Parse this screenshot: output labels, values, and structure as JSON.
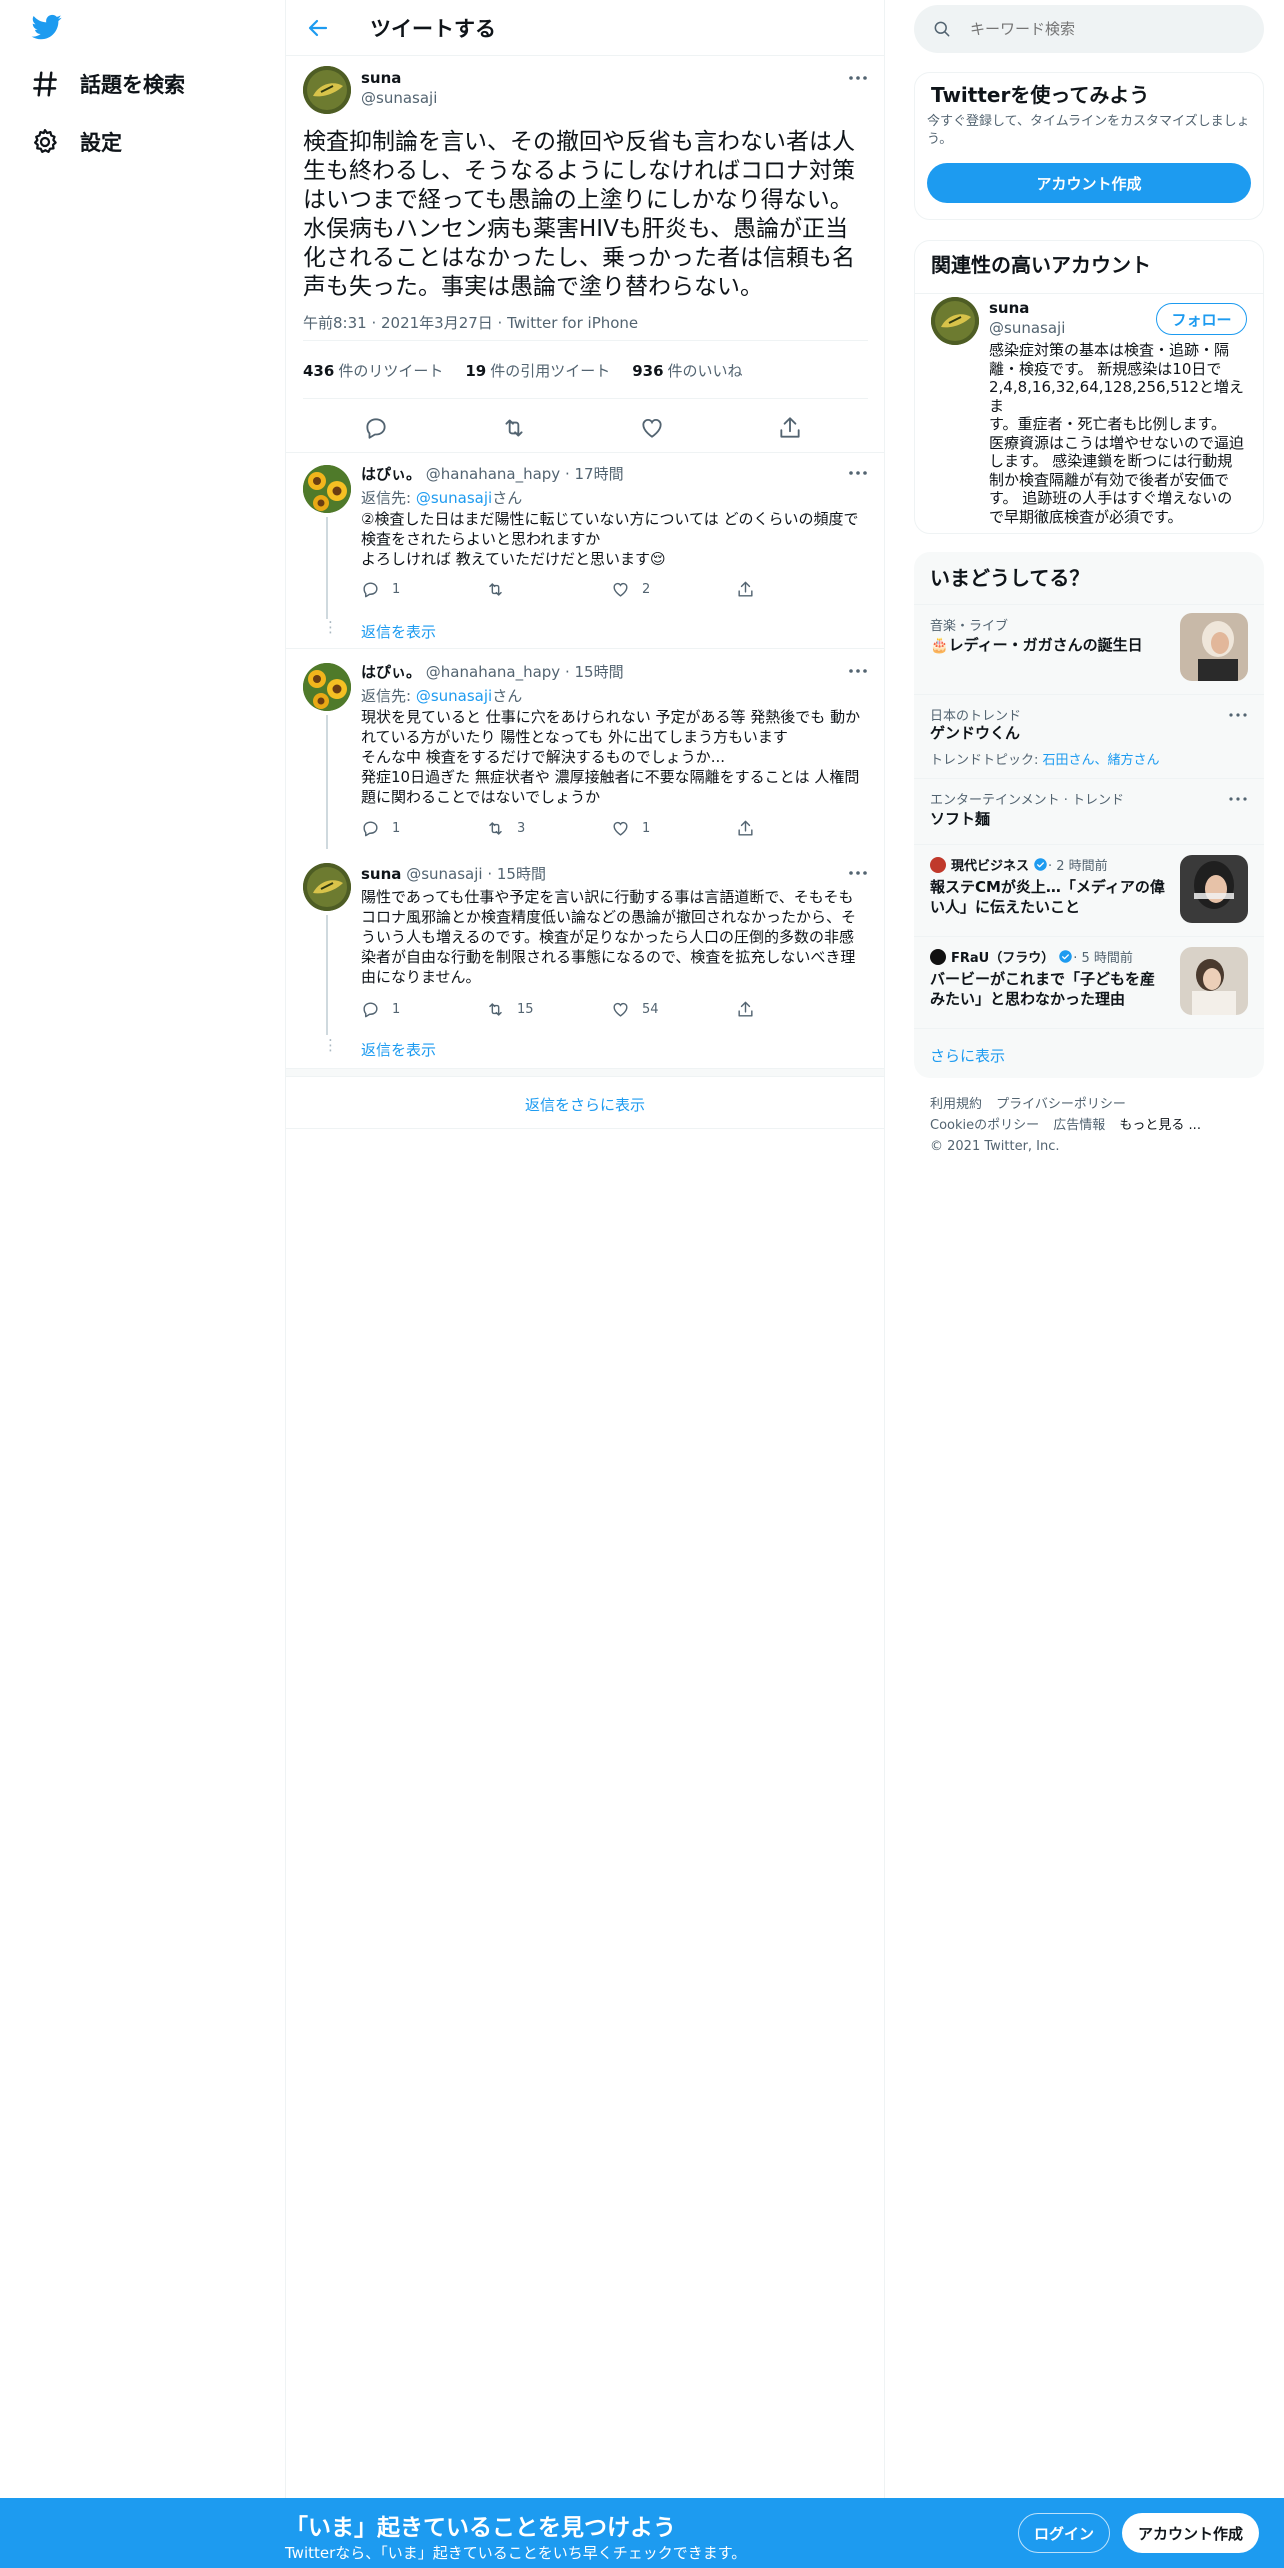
{
  "nav": {
    "explore_label": "話題を検索",
    "settings_label": "設定"
  },
  "header": {
    "title": "ツイートする"
  },
  "tweet": {
    "name": "suna",
    "handle": "@sunasaji",
    "text": "検査抑制論を言い、その撤回や反省も言わない者は人生も終わるし、そうなるようにしなければコロナ対策はいつまで経っても愚論の上塗りにしかなり得ない。水俣病もハンセン病も薬害HIVも肝炎も、愚論が正当化されることはなかったし、乗っかった者は信頼も名声も失った。事実は愚論で塗り替わらない。",
    "meta": "午前8:31 · 2021年3月27日 · Twitter for iPhone",
    "retweets_count": "436",
    "retweets_label": "件のリツイート",
    "quotes_count": "19",
    "quotes_label": "件の引用ツイート",
    "likes_count": "936",
    "likes_label": "件のいいね"
  },
  "replies": [
    {
      "name": "はぴぃ。",
      "handle_time": "@hanahana_hapy · 17時間",
      "reply_prefix": "返信先: ",
      "reply_to": "@sunasaji",
      "reply_suffix": "さん",
      "lines": [
        "②検査した日はまだ陽性に転じていない方については どのくらいの頻度で",
        "検査をされたらよいと思われますか",
        "よろしければ 教えていただけだと思います😌"
      ],
      "reply_count": "1",
      "retweet_count": "",
      "like_count": "2"
    },
    {
      "name": "はぴぃ。",
      "handle_time": "@hanahana_hapy · 15時間",
      "reply_prefix": "返信先: ",
      "reply_to": "@sunasaji",
      "reply_suffix": "さん",
      "lines": [
        "現状を見ていると 仕事に穴をあけられない 予定がある等 発熱後でも 動か",
        "れている方がいたり 陽性となっても 外に出てしまう方もいます",
        "そんな中 検査をするだけで解決するものでしょうか...",
        "発症10日過ぎた 無症状者や 濃厚接触者に不要な隔離をすることは 人権問",
        "題に関わることではないでしょうか"
      ],
      "reply_count": "1",
      "retweet_count": "3",
      "like_count": "1"
    },
    {
      "name": "suna",
      "handle_time": "@sunasaji · 15時間",
      "lines": [
        "陽性であっても仕事や予定を言い訳に行動する事は言語道断で、そもそも",
        "コロナ風邪論とか検査精度低い論などの愚論が撤回されなかったから、そ",
        "ういう人も増えるのです。検査が足りなかったら人口の圧倒的多数の非感",
        "染者が自由な行動を制限される事態になるので、検査を拡充しないべき理",
        "由になりません。"
      ],
      "reply_count": "1",
      "retweet_count": "15",
      "like_count": "54"
    }
  ],
  "show_replies_label": "返信を表示",
  "more_replies_label": "返信をさらに表示",
  "search": {
    "placeholder": "キーワード検索"
  },
  "signup_card": {
    "title": "Twitterを使ってみよう",
    "desc": "今すぐ登録して、タイムラインをカスタマイズしましょう。",
    "button": "アカウント作成"
  },
  "related": {
    "title": "関連性の高いアカウント",
    "name": "suna",
    "handle": "@sunasaji",
    "follow": "フォロー",
    "bio": [
      "感染症対策の基本は検査・追跡・隔",
      "離・検疫です。 新規感染は10日で",
      "2,4,8,16,32,64,128,256,512と増えま",
      "す。重症者・死亡者も比例します。",
      "医療資源はこうは増やせないので逼迫",
      "します。 感染連鎖を断つには行動規",
      "制か検査隔離が有効で後者が安価で",
      "す。 追跡班の人手はすぐ増えないの",
      "で早期徹底検査が必須です。"
    ]
  },
  "trends": {
    "title": "いまどうしてる？",
    "items": [
      {
        "cat": "音楽・ライブ",
        "title": "🎂レディー・ガガさんの誕生日"
      },
      {
        "cat": "日本のトレンド",
        "title": "ゲンドウくん",
        "sub_prefix": "トレンドトピック: ",
        "sub_links": "石田さん、緒方さん"
      },
      {
        "cat": "エンターテインメント · トレンド",
        "title": "ソフト麺"
      },
      {
        "source": "現代ビジネス",
        "time": " · 2 時間前",
        "title": [
          "報ステCMが炎上…「メディアの偉",
          "い人」に伝えたいこと"
        ]
      },
      {
        "source": "FRaU（フラウ）",
        "time": " · 5 時間前",
        "title": [
          "バービーがこれまで「子どもを産",
          "みたい」と思わなかった理由"
        ]
      }
    ],
    "show_more": "さらに表示"
  },
  "footer": {
    "terms": "利用規約",
    "privacy": "プライバシーポリシー",
    "cookie": "Cookieのポリシー",
    "ads": "広告情報",
    "more": "もっと見る ...",
    "copyright": "© 2021 Twitter, Inc."
  },
  "bottom_bar": {
    "headline": "「いま」起きていることを見つけよう",
    "sub": "Twitterなら、「いま」起きていることをいち早くチェックできます。",
    "login": "ログイン",
    "signup": "アカウント作成"
  },
  "colors": {
    "brand": "#1d9bf0",
    "text": "#0f1419",
    "muted": "#536471",
    "border": "#eff3f4"
  }
}
